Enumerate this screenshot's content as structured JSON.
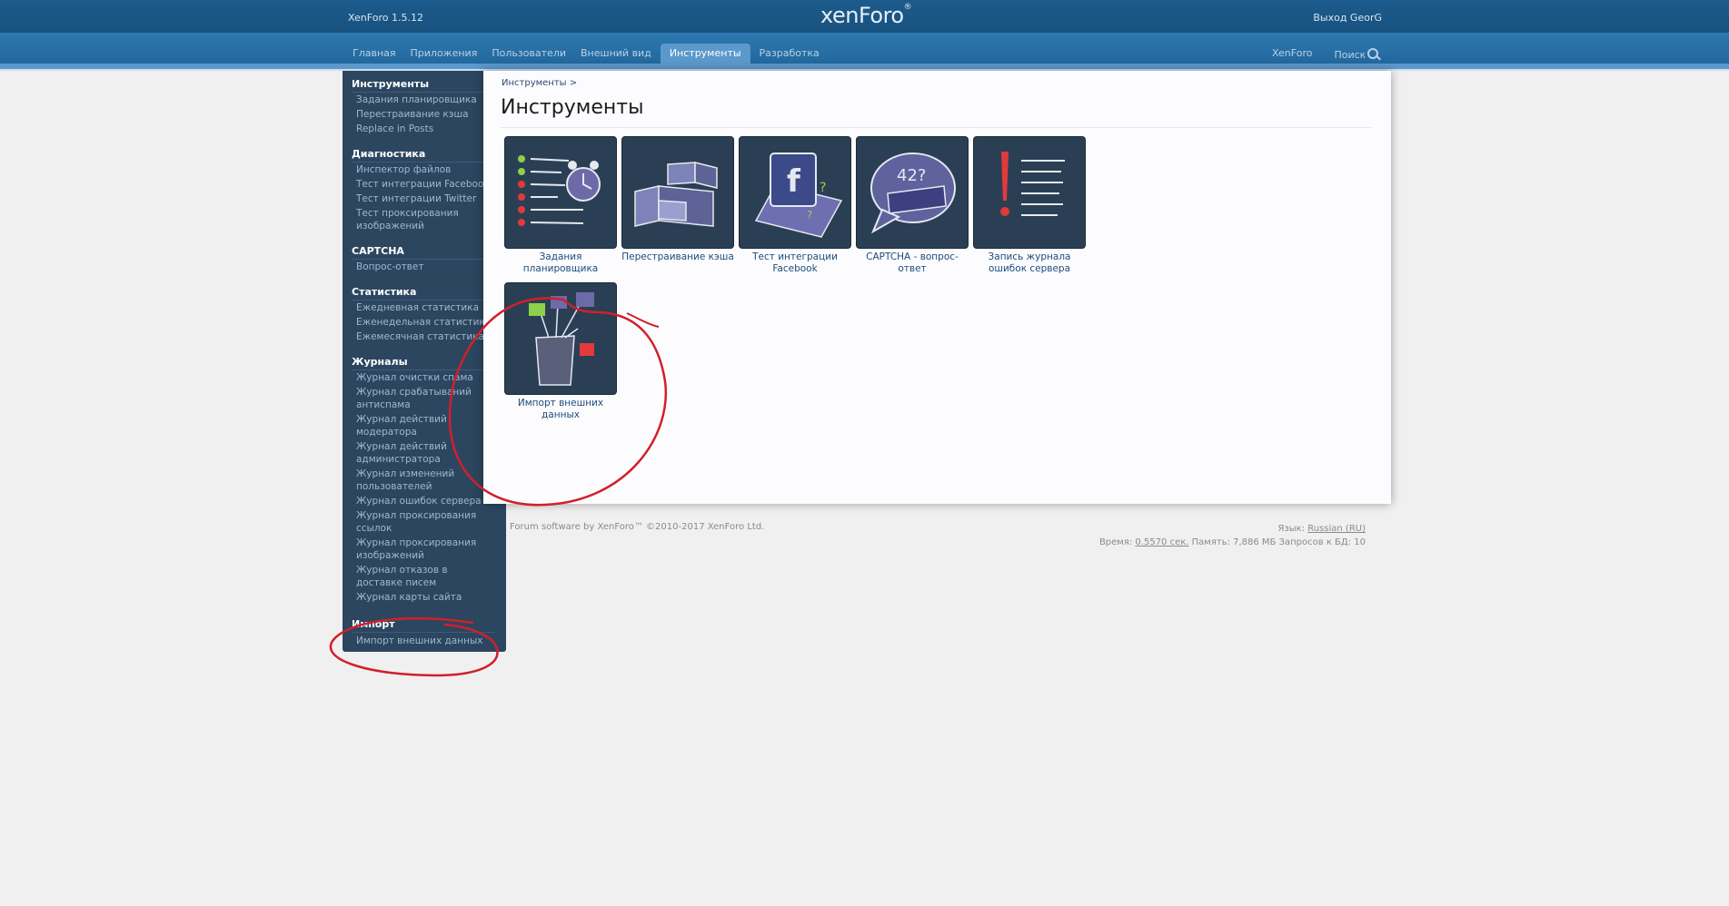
{
  "header": {
    "version": "XenForo 1.5.12",
    "logo": "xenForo",
    "logout": "Выход GeorG"
  },
  "nav": {
    "tabs": [
      "Главная",
      "Приложения",
      "Пользователи",
      "Внешний вид",
      "Инструменты",
      "Разработка"
    ],
    "active_tab": "Инструменты",
    "right": [
      "XenForo",
      "Поиск"
    ]
  },
  "sidebar": {
    "sections": [
      {
        "title": "Инструменты",
        "items": [
          "Задания планировщика",
          "Перестраивание кэша",
          "Replace in Posts"
        ]
      },
      {
        "title": "Диагностика",
        "items": [
          "Инспектор файлов",
          "Тест интеграции Facebook",
          "Тест интеграции Twitter",
          "Тест проксирования изображений"
        ]
      },
      {
        "title": "CAPTCHA",
        "items": [
          "Вопрос-ответ"
        ]
      },
      {
        "title": "Статистика",
        "items": [
          "Ежедневная статистика",
          "Еженедельная статистика",
          "Ежемесячная статистика"
        ]
      },
      {
        "title": "Журналы",
        "items": [
          "Журнал очистки спама",
          "Журнал срабатываний антиспама",
          "Журнал действий модератора",
          "Журнал действий администратора",
          "Журнал изменений пользователей",
          "Журнал ошибок сервера",
          "Журнал проксирования ссылок",
          "Журнал проксирования изображений",
          "Журнал отказов в доставке писем",
          "Журнал карты сайта"
        ]
      },
      {
        "title": "Импорт",
        "items": [
          "Импорт внешних данных"
        ]
      }
    ]
  },
  "content": {
    "breadcrumb": "Инструменты >",
    "title": "Инструменты",
    "tiles": [
      {
        "label": "Задания планировщика",
        "icon": "cron-icon"
      },
      {
        "label": "Перестраивание кэша",
        "icon": "rebuild-cache-icon"
      },
      {
        "label": "Тест интеграции Facebook",
        "icon": "facebook-icon"
      },
      {
        "label": "CAPTCHA - вопрос-ответ",
        "icon": "captcha-icon"
      },
      {
        "label": "Запись журнала ошибок сервера",
        "icon": "error-log-icon"
      },
      {
        "label": "Импорт внешних данных",
        "icon": "import-icon"
      }
    ]
  },
  "footer": {
    "copyright": "Forum software by XenForo™ ©2010-2017 XenForo Ltd.",
    "language_label": "Язык:",
    "language_value": "Russian (RU)",
    "time_label": "Время:",
    "time_value": "0.5570 сек.",
    "stats": "Память: 7,886 МБ Запросов к БД: 10"
  },
  "colors": {
    "header": "#1c5b8c",
    "sidebar": "#2c4660",
    "tile": "#2b3f54",
    "annotation": "#d0202a"
  }
}
